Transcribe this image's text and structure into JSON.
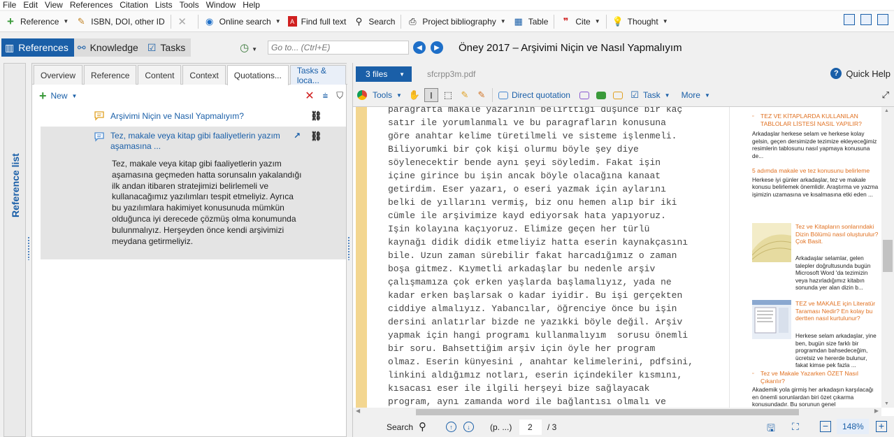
{
  "menu": [
    "File",
    "Edit",
    "View",
    "References",
    "Citation",
    "Lists",
    "Tools",
    "Window",
    "Help"
  ],
  "toolbar": {
    "reference": "Reference",
    "isbn": "ISBN, DOI, other ID",
    "online_search": "Online search",
    "find_full_text": "Find full text",
    "search": "Search",
    "project_bibliography": "Project bibliography",
    "table": "Table",
    "cite": "Cite",
    "thought": "Thought"
  },
  "nav": {
    "references": "References",
    "knowledge": "Knowledge",
    "tasks": "Tasks",
    "goto_placeholder": "Go to... (Ctrl+E)"
  },
  "document_title": "Öney 2017 – Arşivimi Niçin ve Nasıl Yapmalıyım",
  "reference_list_label": "Reference list",
  "panel_tabs": [
    "Overview",
    "Reference",
    "Content",
    "Context",
    "Quotations...",
    "Tasks & loca..."
  ],
  "quotations": {
    "new_label": "New",
    "items": [
      {
        "title": "Arşivimi Niçin ve Nasıl Yapmalıyım?"
      },
      {
        "title": "Tez, makale veya kitap gibi faaliyetlerin yazım aşamasına  ...",
        "body": "Tez, makale veya kitap gibi faaliyetlerin yazım aşamasına geçmeden hatta sorunsalın yakalandığı ilk andan itibaren stratejimizi belirlemeli ve kullanacağımız yazılımları tespit etmeliyiz. Ayrıca bu yazılımlara hakimiyet konusunuda mümkün olduğunca iyi derecede çözmüş olma konumunda bulunmalıyız. Herşeyden önce kendi arşivimizi meydana getirmeliyiz."
      }
    ]
  },
  "files": {
    "count_label": "3 files",
    "filename": "sfcrpp3m.pdf",
    "quick_help": "Quick Help"
  },
  "pdf_toolbar": {
    "tools": "Tools",
    "direct_quotation": "Direct quotation",
    "task": "Task",
    "more": "More"
  },
  "pdf_lines": [
    "paragrafta makale yazarının belirttiği düşünce bir kaç",
    "satır ile yorumlanmalı ve bu paragrafların konusuna",
    "göre anahtar kelime türetilmeli ve sisteme işlenmeli.",
    "Biliyorumki bir çok kişi olurmu böyle şey diye",
    "söylenecektir bende aynı şeyi söyledim. Fakat işin",
    "içine girince bu işin ancak böyle olacağına kanaat",
    "getirdim. Eser yazarı, o eseri yazmak için aylarını",
    "belki de yıllarını vermiş, biz onu hemen alıp bir iki",
    "cümle ile arşivimize kayd ediyorsak hata yapıyoruz.",
    "Işin kolayına kaçıyoruz. Elimize geçen her türlü",
    "kaynağı didik didik etmeliyiz hatta eserin kaynakçasını",
    "bile. Uzun zaman sürebilir fakat harcadığımız o zaman",
    "boşa gitmez. Kıymetli arkadaşlar bu nedenle arşiv",
    "çalışmamıza çok erken yaşlarda başlamalıyız, yada ne",
    "kadar erken başlarsak o kadar iyidir. Bu işi gerçekten",
    "ciddiye almalıyız. Yabancılar, öğrenciye önce bu işin",
    "dersini anlatırlar bizde ne yazıkki böyle değil. Arşiv",
    "yapmak için hangi programı kullanmalıyım  sorusu önemli",
    "bir soru. Bahsettiğim arşiv için öyle her program",
    "olmaz. Eserin künyesini , anahtar kelimelerini, pdfsini,",
    "linkini aldığımız notları, eserin içindekiler kısmını,",
    "kısacası eser ile ilgili herşeyi bize sağlayacak",
    "program, aynı zamanda word ile bağlantısı olmalı ve"
  ],
  "side_articles": [
    {
      "title": "TEZ VE KİTAPLARDA KULLANILAN TABLOLAR LİSTESİ NASIL YAPILIR?",
      "body": "Arkadaşlar herkese selam ve herkese kolay gelsin, geçen dersimizde tezimize ekleyeceğimiz resimlerin tablosunu nasıl yapmaya konusuna de..."
    },
    {
      "title": "5 adımda makale ve tez konusunu belirleme",
      "body": "Herkese iyi günler arkadaşlar, tez ve makale konusu belirlemek önemlidir. Araştırma ve yazma işimizin uzamasına ve kısalmasına etki eden ..."
    },
    {
      "title": "Tez ve Kitapların sonlarındaki Dizin Bölümü nasıl oluşturulur? Çok Basit.",
      "body": "Arkadaşlar selamlar, gelen talepler doğrultusunda bugün Microsoft Word 'da tezimizin veya hazırladığımız kitabın sonunda yer alan dizin b..."
    },
    {
      "title": "TEZ ve MAKALE için Literatür Taraması Nedir? En kolay bu dertten nasıl kurtulunur?",
      "body": "Herkese selam arkadaşlar, yine ben, bugün size farklı bir programdan bahsedeceğim, ücretsiz ve hererde bulunur, fakat kimse pek fazla ..."
    },
    {
      "title": "Tez ve Makale Yazarken ÖZET Nasıl Çıkarılır?",
      "body": "Akademik yola girmiş her arkadaşın karşılacağı en önemli sorunlardan biri özet çıkarma konusundadır. Bu sorunun genel"
    }
  ],
  "status": {
    "search": "Search",
    "page_prefix": "(p. ...)",
    "page": "2",
    "of": "/ 3",
    "zoom": "148%"
  },
  "colors": {
    "accent": "#1a5fa8",
    "highlight": "#f3d690",
    "link_orange": "#e07020"
  }
}
